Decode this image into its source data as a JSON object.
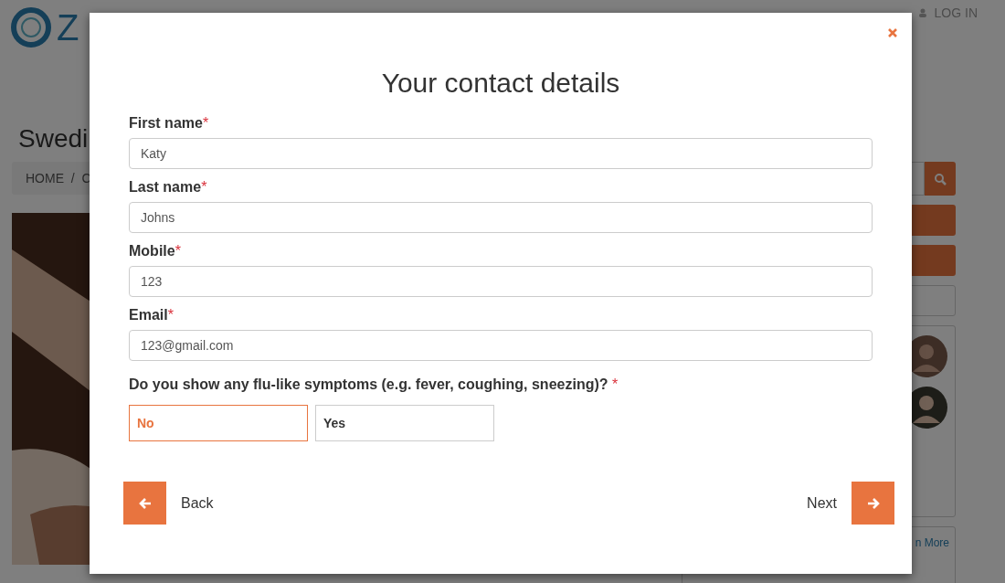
{
  "page": {
    "logo_text": "Z",
    "nav": [
      {
        "label": "LOG IN"
      }
    ],
    "heading": "Swedi",
    "breadcrumb": "HOME  /  C",
    "sidebar_link": "n More"
  },
  "modal": {
    "title": "Your contact details",
    "required_mark": "*",
    "fields": [
      {
        "label": "First name",
        "required": true,
        "value": "Katy"
      },
      {
        "label": "Last name",
        "required": true,
        "value": "Johns"
      },
      {
        "label": "Mobile",
        "required": true,
        "value": "123"
      },
      {
        "label": "Email",
        "required": true,
        "value": "123@gmail.com"
      }
    ],
    "question": {
      "label": "Do you show any flu-like symptoms (e.g. fever, coughing, sneezing)?",
      "required": true,
      "options": [
        {
          "label": "No",
          "selected": true
        },
        {
          "label": "Yes",
          "selected": false
        }
      ]
    },
    "back": "Back",
    "next": "Next"
  }
}
